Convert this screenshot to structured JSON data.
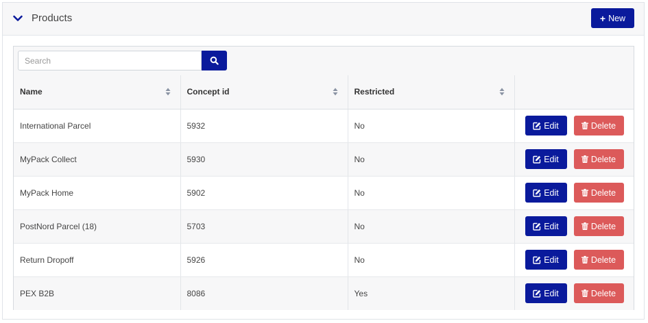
{
  "header": {
    "title": "Products",
    "new_label": "New",
    "collapse_icon": "chevron-down-icon",
    "accent_color": "#0a1a9c"
  },
  "search": {
    "placeholder": "Search",
    "value": "",
    "icon": "search-icon"
  },
  "table": {
    "columns": [
      {
        "label": "Name"
      },
      {
        "label": "Concept id"
      },
      {
        "label": "Restricted"
      },
      {
        "label": ""
      }
    ],
    "edit_label": "Edit",
    "delete_label": "Delete",
    "edit_color": "#0a1a9c",
    "delete_color": "#dc5a5a",
    "rows": [
      {
        "name": "International Parcel",
        "concept_id": "5932",
        "restricted": "No"
      },
      {
        "name": "MyPack Collect",
        "concept_id": "5930",
        "restricted": "No"
      },
      {
        "name": "MyPack Home",
        "concept_id": "5902",
        "restricted": "No"
      },
      {
        "name": "PostNord Parcel (18)",
        "concept_id": "5703",
        "restricted": "No"
      },
      {
        "name": "Return Dropoff",
        "concept_id": "5926",
        "restricted": "No"
      },
      {
        "name": "PEX B2B",
        "concept_id": "8086",
        "restricted": "Yes"
      }
    ]
  }
}
